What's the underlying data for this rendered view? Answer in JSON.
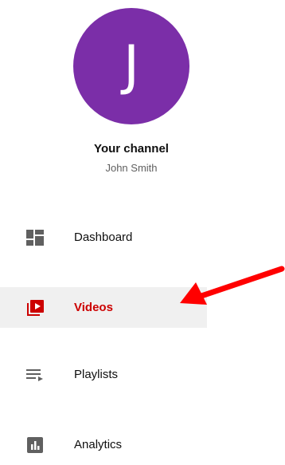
{
  "channel": {
    "avatar_letter": "J",
    "avatar_color": "#7b2ea8",
    "title": "Your channel",
    "name": "John Smith"
  },
  "nav": {
    "items": [
      {
        "label": "Dashboard",
        "icon": "dashboard-icon",
        "active": false
      },
      {
        "label": "Videos",
        "icon": "video-library-icon",
        "active": true
      },
      {
        "label": "Playlists",
        "icon": "playlist-icon",
        "active": false
      },
      {
        "label": "Analytics",
        "icon": "analytics-icon",
        "active": false
      }
    ]
  },
  "colors": {
    "active_accent": "#cc0000",
    "active_background": "#f0f0f0",
    "icon_gray": "#606060",
    "annotation_arrow": "#ff0000"
  }
}
